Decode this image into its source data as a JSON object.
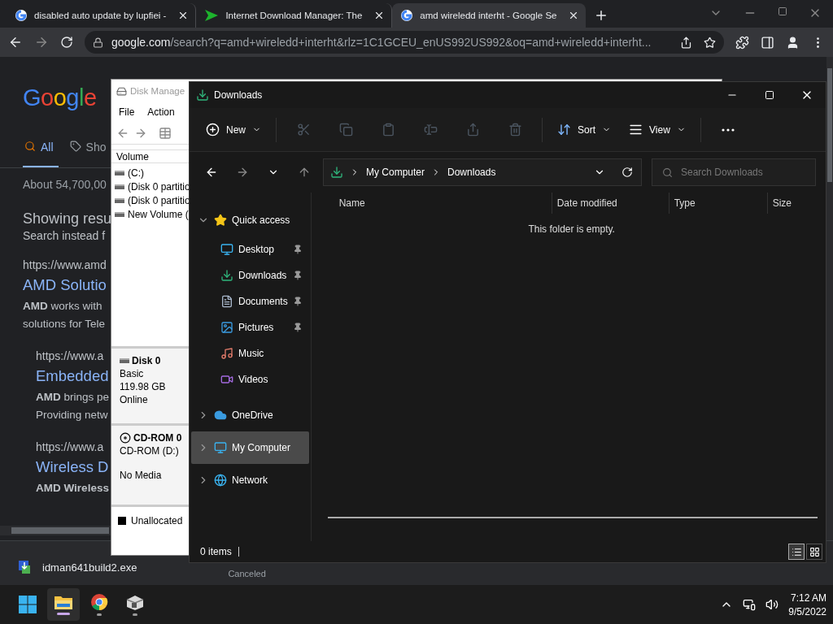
{
  "browser": {
    "tabs": [
      {
        "title": "disabled auto update by lupfiei -",
        "kind": "google",
        "selected": false
      },
      {
        "title": "Internet Download Manager: The",
        "kind": "idm",
        "selected": false
      },
      {
        "title": "amd wireledd interht - Google Se",
        "kind": "google",
        "selected": true
      }
    ],
    "address": {
      "host": "google.com",
      "path": "/search?q=amd+wireledd+interht&rlz=1C1GCEU_enUS992US992&oq=amd+wireledd+interht..."
    }
  },
  "search_page": {
    "logo": "Google",
    "nav": [
      {
        "label": "All",
        "kind": "search",
        "selected": true
      },
      {
        "label": "Sho",
        "kind": "tag",
        "selected": false
      }
    ],
    "result_stats": "About 54,700,00",
    "correction": [
      "Showing resu",
      "Search instead f"
    ],
    "results": [
      {
        "url": "https://www.amd",
        "title": "AMD Solutio",
        "snippet": [
          "**AMD** works with",
          "solutions for Tele"
        ],
        "children": [
          {
            "url": "https://www.a",
            "title": "Embedded",
            "snippet": [
              "**AMD** brings pe",
              "Providing netw"
            ]
          },
          {
            "url": "https://www.a",
            "title": "Wireless D",
            "snippet": [
              "**AMD Wireless**"
            ]
          }
        ]
      }
    ]
  },
  "downloads_shelf": {
    "file": "idman641build2.exe",
    "status": "Canceled"
  },
  "disk_management": {
    "title": "Disk Manage",
    "menu": [
      "File",
      "Action"
    ],
    "volume_header": "Volume",
    "volumes": [
      "(C:)",
      "(Disk 0 partitio",
      "(Disk 0 partitio",
      "New Volume ("
    ],
    "disks": [
      {
        "kind": "disk",
        "name": "Disk 0",
        "lines": [
          "Basic",
          "119.98 GB",
          "Online"
        ]
      },
      {
        "kind": "cdrom",
        "name": "CD-ROM 0",
        "lines": [
          "CD-ROM (D:)",
          "No Media"
        ]
      }
    ],
    "legend": "Unallocated"
  },
  "explorer": {
    "title": "Downloads",
    "toolbar": [
      {
        "kind": "new",
        "label": "New",
        "disabled": false
      },
      {
        "kind": "cut",
        "disabled": true
      },
      {
        "kind": "copy",
        "disabled": true
      },
      {
        "kind": "paste",
        "disabled": true
      },
      {
        "kind": "rename",
        "disabled": true
      },
      {
        "kind": "share",
        "disabled": true
      },
      {
        "kind": "delete",
        "disabled": true
      },
      {
        "kind": "sort",
        "label": "Sort",
        "disabled": false
      },
      {
        "kind": "view",
        "label": "View",
        "disabled": false
      },
      {
        "kind": "more",
        "disabled": false
      }
    ],
    "path": [
      "My Computer",
      "Downloads"
    ],
    "search_placeholder": "Search Downloads",
    "nav": [
      {
        "label": "Quick access",
        "kind": "star",
        "expanded": true,
        "selected": false,
        "children": [
          {
            "label": "Desktop",
            "kind": "desktop",
            "pinned": true,
            "selected": false
          },
          {
            "label": "Downloads",
            "kind": "downloads",
            "pinned": true,
            "selected": false
          },
          {
            "label": "Documents",
            "kind": "documents",
            "pinned": true,
            "selected": false
          },
          {
            "label": "Pictures",
            "kind": "pictures",
            "pinned": true,
            "selected": false
          },
          {
            "label": "Music",
            "kind": "music",
            "pinned": false,
            "selected": false
          },
          {
            "label": "Videos",
            "kind": "videos",
            "pinned": false,
            "selected": false
          }
        ]
      },
      {
        "label": "OneDrive",
        "kind": "cloud",
        "expanded": false,
        "selected": false
      },
      {
        "label": "My Computer",
        "kind": "computer",
        "expanded": false,
        "selected": true
      },
      {
        "label": "Network",
        "kind": "network",
        "expanded": false,
        "selected": false
      }
    ],
    "columns": [
      "Name",
      "Date modified",
      "Type",
      "Size"
    ],
    "empty_message": "This folder is empty.",
    "status": "0 items",
    "views": [
      {
        "kind": "details",
        "selected": true
      },
      {
        "kind": "tiles",
        "selected": false
      }
    ]
  },
  "taskbar": {
    "apps": [
      {
        "kind": "explorer",
        "active": true
      },
      {
        "kind": "chrome",
        "active": false
      },
      {
        "kind": "app",
        "active": false
      }
    ],
    "time": "7:12 AM",
    "date": "9/5/2022"
  }
}
